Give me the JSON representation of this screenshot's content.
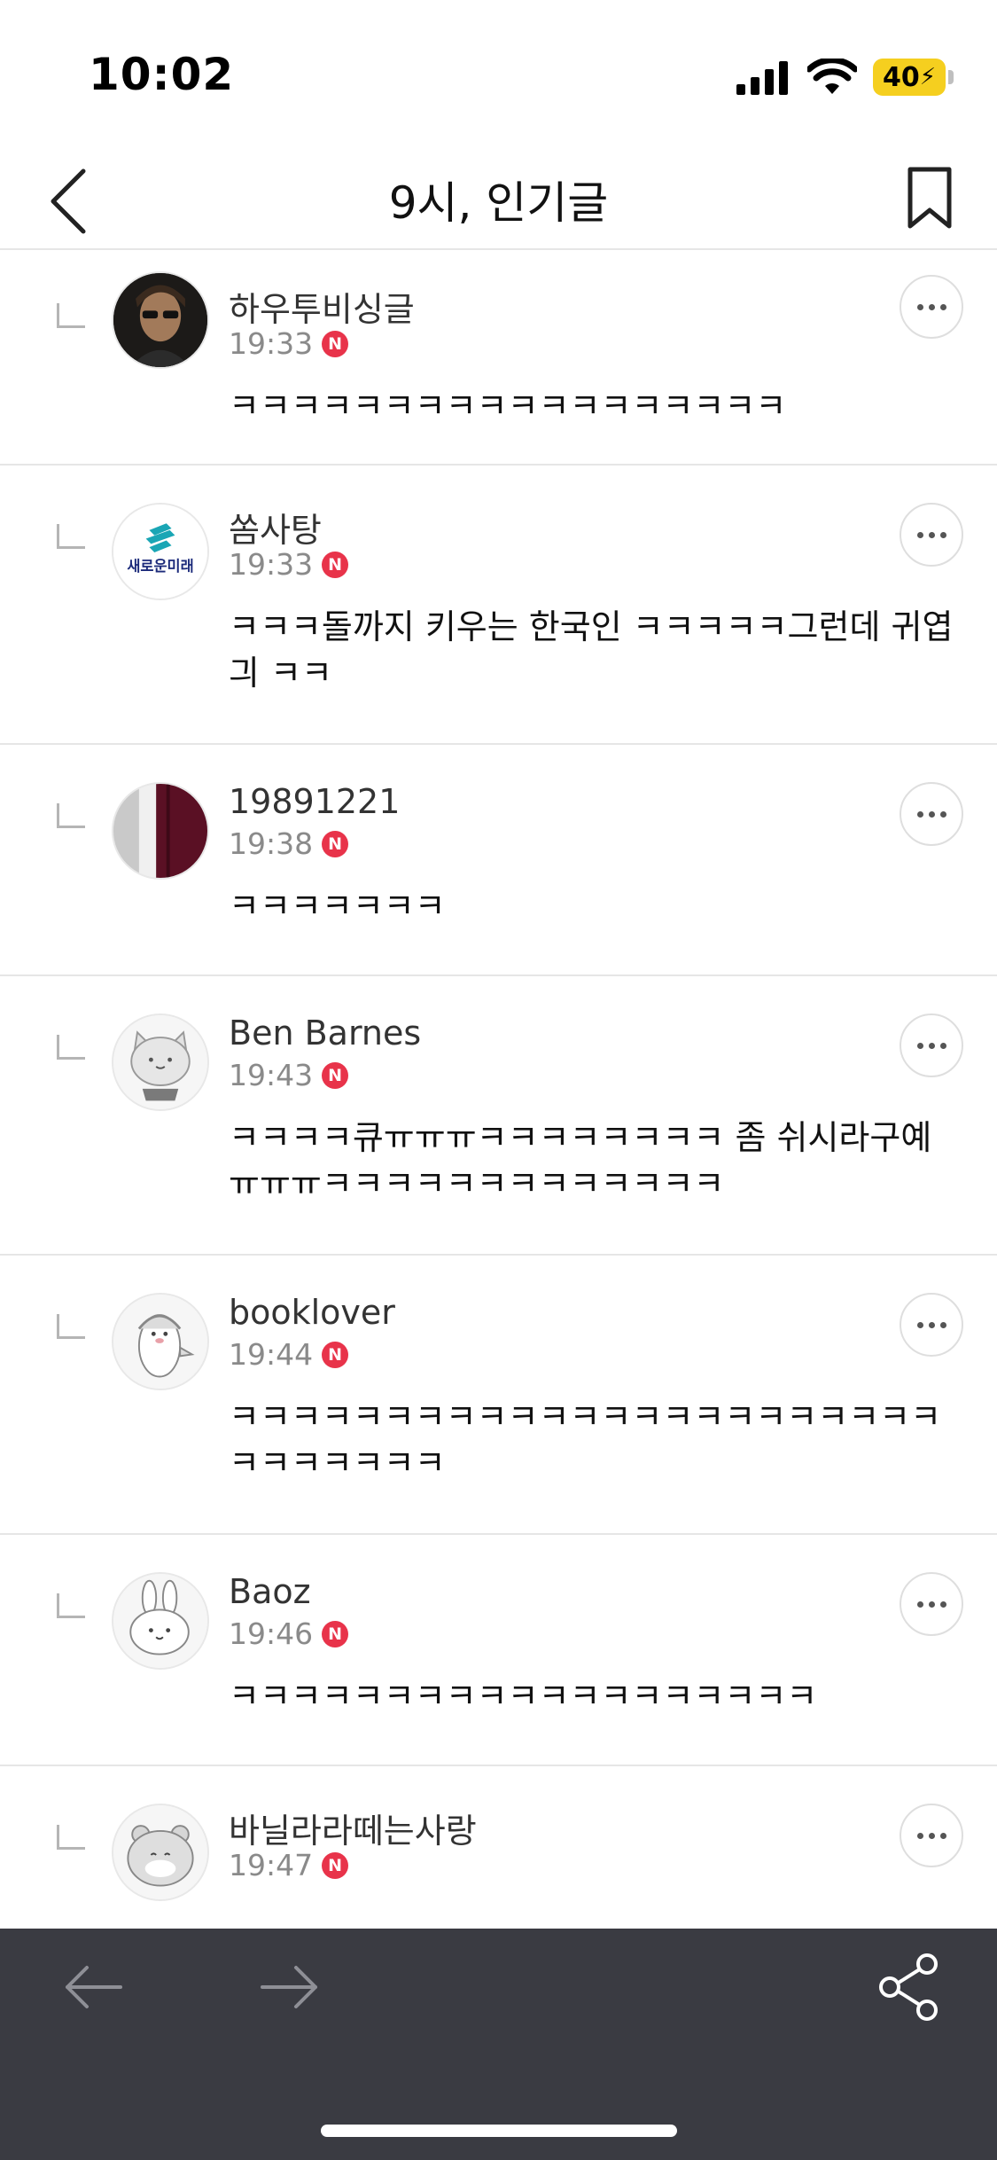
{
  "status_bar": {
    "time": "10:02",
    "battery": "40"
  },
  "header": {
    "title": "9시, 인기글"
  },
  "comments": [
    {
      "nickname": "하우투비싱글",
      "time": "19:33",
      "badge": "N",
      "text": "ㅋㅋㅋㅋㅋㅋㅋㅋㅋㅋㅋㅋㅋㅋㅋㅋㅋㅋ",
      "avatar": "photo-avatar"
    },
    {
      "nickname": "쏨사탕",
      "time": "19:33",
      "badge": "N",
      "text": "ㅋㅋㅋ돌까지 키우는 한국인 ㅋㅋㅋㅋㅋ그런데 귀엽긔 ㅋㅋ",
      "avatar": "logo-avatar",
      "avatar_text": "새로운미래"
    },
    {
      "nickname": "19891221",
      "time": "19:38",
      "badge": "N",
      "text": "ㅋㅋㅋㅋㅋㅋㅋ",
      "avatar": "fabric-avatar"
    },
    {
      "nickname": "Ben Barnes",
      "time": "19:43",
      "badge": "N",
      "text": "ㅋㅋㅋㅋ큐ㅠㅠㅠㅋㅋㅋㅋㅋㅋㅋㅋ 좀 쉬시라구예 ㅠㅠㅠㅋㅋㅋㅋㅋㅋㅋㅋㅋㅋㅋㅋㅋ",
      "avatar": "cat-avatar"
    },
    {
      "nickname": "booklover",
      "time": "19:44",
      "badge": "N",
      "text": "ㅋㅋㅋㅋㅋㅋㅋㅋㅋㅋㅋㅋㅋㅋㅋㅋㅋㅋㅋㅋㅋㅋㅋㅋㅋㅋㅋㅋㅋㅋ",
      "avatar": "penguin-avatar"
    },
    {
      "nickname": "Baoz",
      "time": "19:46",
      "badge": "N",
      "text": "ㅋㅋㅋㅋㅋㅋㅋㅋㅋㅋㅋㅋㅋㅋㅋㅋㅋㅋㅋ",
      "avatar": "bunny-avatar"
    },
    {
      "nickname": "바닐라라떼는사랑",
      "time": "19:47",
      "badge": "N",
      "text": "",
      "avatar": "hamster-avatar"
    }
  ],
  "icons": {
    "back": "chevron-left-icon",
    "bookmark": "bookmark-icon",
    "more": "ellipsis-icon",
    "nav_back": "arrow-left-icon",
    "nav_forward": "arrow-right-icon",
    "share": "share-icon"
  },
  "colors": {
    "badge": "#e8334a",
    "toolbar": "#3a3b42",
    "battery": "#f5cf1f"
  }
}
